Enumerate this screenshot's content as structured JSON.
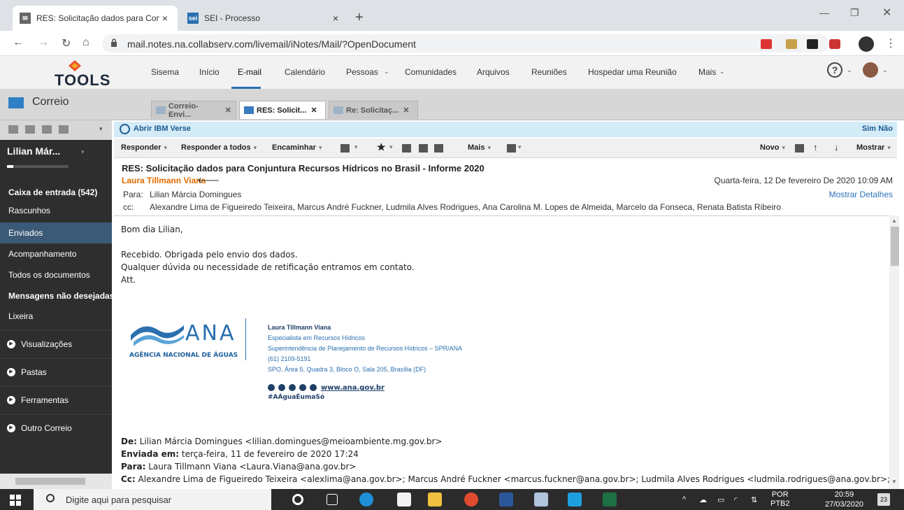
{
  "browser": {
    "tabs": [
      {
        "title": "RES: Solicitação dados para Conj",
        "favicon": "mail-envelope-icon"
      },
      {
        "title": "SEI - Processo",
        "favicon": "sei-icon",
        "favicon_text": "sei"
      }
    ],
    "url": "mail.notes.na.collabserv.com/livemail/iNotes/Mail/?OpenDocument"
  },
  "app": {
    "logo_text": "TOOLS",
    "nav": [
      "Sisema",
      "Início",
      "E-mail",
      "Calendário",
      "Pessoas",
      "Comunidades",
      "Arquivos",
      "Reuniões",
      "Hospedar uma Reunião",
      "Mais"
    ],
    "help_glyph": "?"
  },
  "correio": {
    "label": "Correio",
    "doc_tabs": [
      "Correio-Envi...",
      "RES: Solicit...",
      "Re: Solicitaç..."
    ]
  },
  "sidebar": {
    "user": "Lilian Már...",
    "storage_fraction": 0.1,
    "items": [
      "Caixa de entrada (542)",
      "Rascunhos",
      "Enviados",
      "Acompanhamento",
      "Todos os documentos",
      "Mensagens não desejadas",
      "Lixeira"
    ],
    "selected": "Enviados",
    "sections": [
      "Visualizações",
      "Pastas",
      "Ferramentas",
      "Outro Correio"
    ]
  },
  "verse_bar": {
    "link": "Abrir IBM Verse",
    "yes": "Sim",
    "no": "Não"
  },
  "actions": {
    "reply": "Responder",
    "reply_all": "Responder a todos",
    "forward": "Encaminhar",
    "more": "Mais",
    "new": "Novo",
    "show": "Mostrar"
  },
  "message": {
    "subject": "RES: Solicitação dados para Conjuntura Recursos Hídricos no Brasil - Informe 2020",
    "sender": "Laura Tillmann Viana",
    "date": "Quarta-feira, 12 De fevereiro De 2020 10:09 AM",
    "show_details": "Mostrar Detalhes",
    "to_label": "Para:",
    "to": "Lilian Márcia Domingues",
    "cc_label": "cc:",
    "cc": "Alexandre Lima de Figueiredo Teixeira, Marcus André Fuckner, Ludmila Alves Rodrigues, Ana Carolina M. Lopes de Almeida, Marcelo da Fonseca, Renata Batista Ribeiro"
  },
  "body": {
    "greeting": "Bom dia Lilian,",
    "line1": "Recebido. Obrigada pelo envio dos dados.",
    "line2": "Qualquer dúvida ou necessidade de retificação entramos em contato.",
    "line3": "Att.",
    "signature": {
      "logo": "ANA",
      "agency": "AGÊNCIA NACIONAL DE ÁGUAS",
      "name": "Laura Tillmann Viana",
      "role": "Especialista em Recursos Hídricos",
      "dept": "Superintendência de Planejamento de Recursos Hídricos – SPR/ANA",
      "phone": "(61) 2109-5191",
      "address": "SPO, Área 5, Quadra 3, Bloco O, Sala 205, Brasília (DF)",
      "website": "www.ana.gov.br",
      "hashtag": "#AÁguaÉumaSó"
    },
    "quoted": {
      "from_label": "De:",
      "from": "Lilian Márcia Domingues <lilian.domingues@meioambiente.mg.gov.br>",
      "sent_label": "Enviada em:",
      "sent": "terça-feira, 11 de fevereiro de 2020 17:24",
      "to_label": "Para:",
      "to": "Laura Tillmann Viana <Laura.Viana@ana.gov.br>",
      "cc_label": "Cc:",
      "cc": "Alexandre Lima de Figueiredo Teixeira <alexlima@ana.gov.br>; Marcus André Fuckner <marcus.fuckner@ana.gov.br>; Ludmila Alves Rodrigues <ludmila.rodrigues@ana.gov.br>;"
    }
  },
  "taskbar": {
    "search_placeholder": "Digite aqui para pesquisar",
    "lang_top": "POR",
    "lang_bottom": "PTB2",
    "time": "20:59",
    "date": "27/03/2020",
    "notifications": "23"
  }
}
